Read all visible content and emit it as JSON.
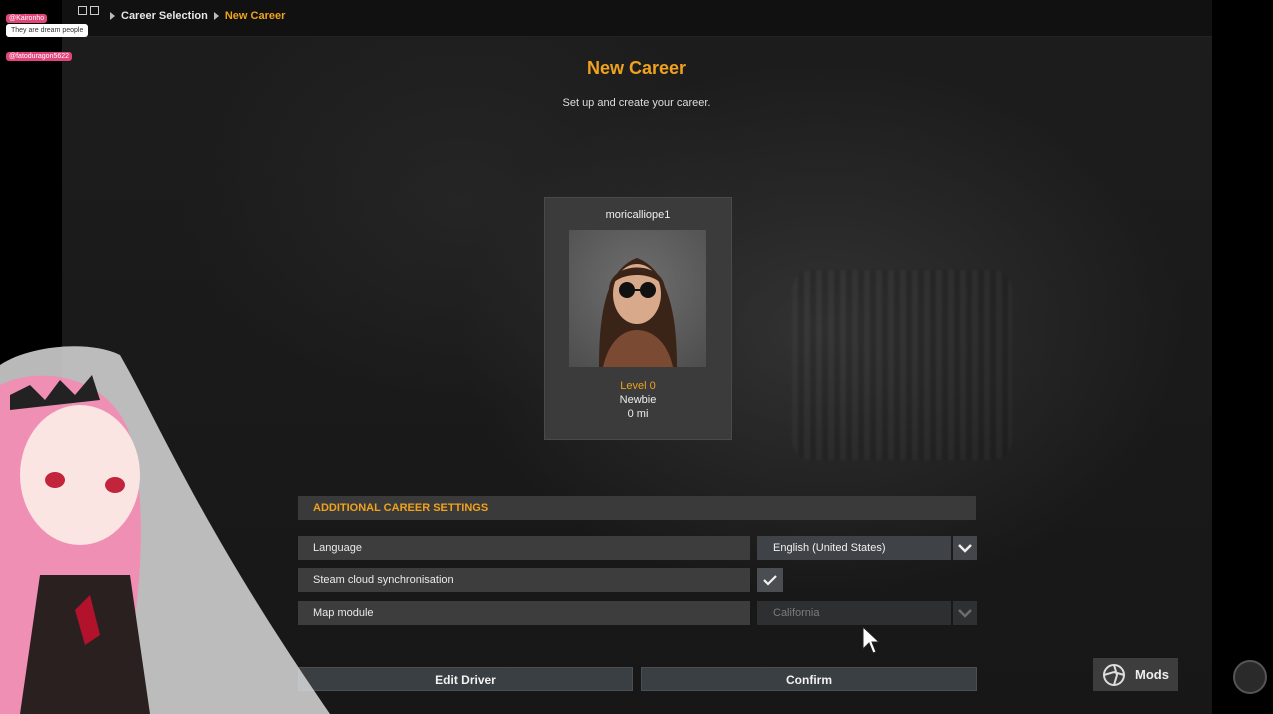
{
  "breadcrumb": [
    "Career Selection",
    "New Career"
  ],
  "page": {
    "title": "New Career",
    "subtitle": "Set up and create your career."
  },
  "profile": {
    "username": "moricalliope1",
    "level": "Level 0",
    "rank": "Newbie",
    "distance": "0 mi"
  },
  "settings": {
    "header": "ADDITIONAL CAREER SETTINGS",
    "language": {
      "label": "Language",
      "value": "English (United States)"
    },
    "steam_sync": {
      "label": "Steam cloud synchronisation",
      "checked": true
    },
    "map_module": {
      "label": "Map module",
      "value": "California",
      "enabled": false
    }
  },
  "buttons": {
    "edit_driver": "Edit Driver",
    "confirm": "Confirm",
    "mods": "Mods"
  },
  "overlay": {
    "chat": [
      {
        "user": "@Kaironho",
        "message": "They are dream people"
      },
      {
        "user": "@fatoduragon5622",
        "message": ""
      }
    ]
  },
  "colors": {
    "accent": "#f0a21d",
    "panel": "#3b3b3b",
    "button": "#3a3f44"
  }
}
